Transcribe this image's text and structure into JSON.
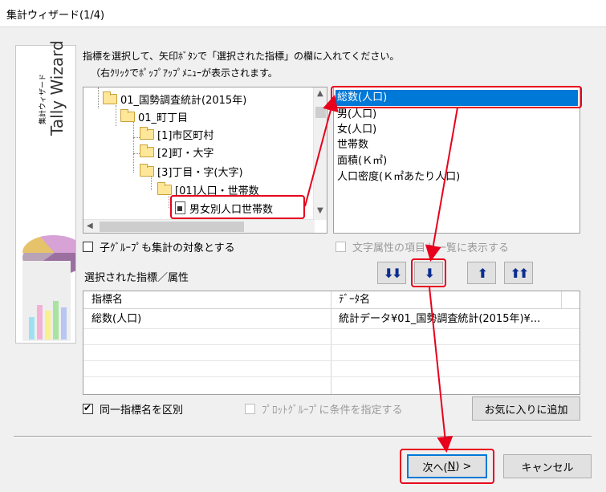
{
  "window": {
    "title": "集計ウィザード(1/4)"
  },
  "sidebar": {
    "small_text": "集計ウィザード",
    "big_text": "Tally Wizard"
  },
  "instructions": {
    "line1": "指標を選択して、矢印ﾎﾞﾀﾝで「選択された指標」の欄に入れてください。",
    "line2": "（右ｸﾘｯｸでﾎﾟｯﾌﾟｱｯﾌﾟﾒﾆｭｰが表示されます。"
  },
  "tree": {
    "items": [
      {
        "label": "01_国勢調査統計(2015年)",
        "icon": "folder-icon"
      },
      {
        "label": "01_町丁目",
        "icon": "folder-icon"
      },
      {
        "label": "[1]市区町村",
        "icon": "folder-icon"
      },
      {
        "label": "[2]町・大字",
        "icon": "folder-icon"
      },
      {
        "label": "[3]丁目・字(大字)",
        "icon": "folder-icon"
      },
      {
        "label": "[01]人口・世帯数",
        "icon": "folder-icon"
      },
      {
        "label": "男女別人口世帯数",
        "icon": "table-doc-icon"
      }
    ]
  },
  "indicator_list": {
    "items": [
      "総数(人口)",
      "男(人口)",
      "女(人口)",
      "世帯数",
      "面積(Ｋ㎡)",
      "人口密度(Ｋ㎡あたり人口)"
    ],
    "selected_index": 0
  },
  "options": {
    "include_child_groups": {
      "label": "子ｸﾞﾙｰﾌﾟも集計の対象とする",
      "checked": false
    },
    "show_text_attrs": {
      "label": "文字属性の項目も一覧に表示する",
      "checked": false,
      "enabled": false
    },
    "distinguish_same_name": {
      "label": "同一指標名を区別",
      "checked": true
    },
    "plot_group_condition": {
      "label": "ﾌﾟﾛｯﾄｸﾞﾙｰﾌﾟに条件を指定する",
      "checked": false,
      "enabled": false
    }
  },
  "selected_section": {
    "title": "選択された指標／属性"
  },
  "arrow_buttons": {
    "add_all": "⬇⬇",
    "add_one": "⬇",
    "remove_one": "⬆",
    "remove_all": "⬆⬆"
  },
  "grid": {
    "columns": [
      "指標名",
      "ﾃﾞｰﾀ名"
    ],
    "rows": [
      [
        "総数(人口)",
        "統計データ¥01_国勢調査統計(2015年)¥..."
      ]
    ]
  },
  "buttons": {
    "favorite": "お気に入りに追加",
    "next_prefix": "次へ(",
    "next_key": "N",
    "next_suffix": ") >",
    "cancel": "キャンセル"
  },
  "colors": {
    "highlight": "#e8001c",
    "selection": "#0078d7",
    "arrow_button_glyph": "#0a2d8f"
  }
}
